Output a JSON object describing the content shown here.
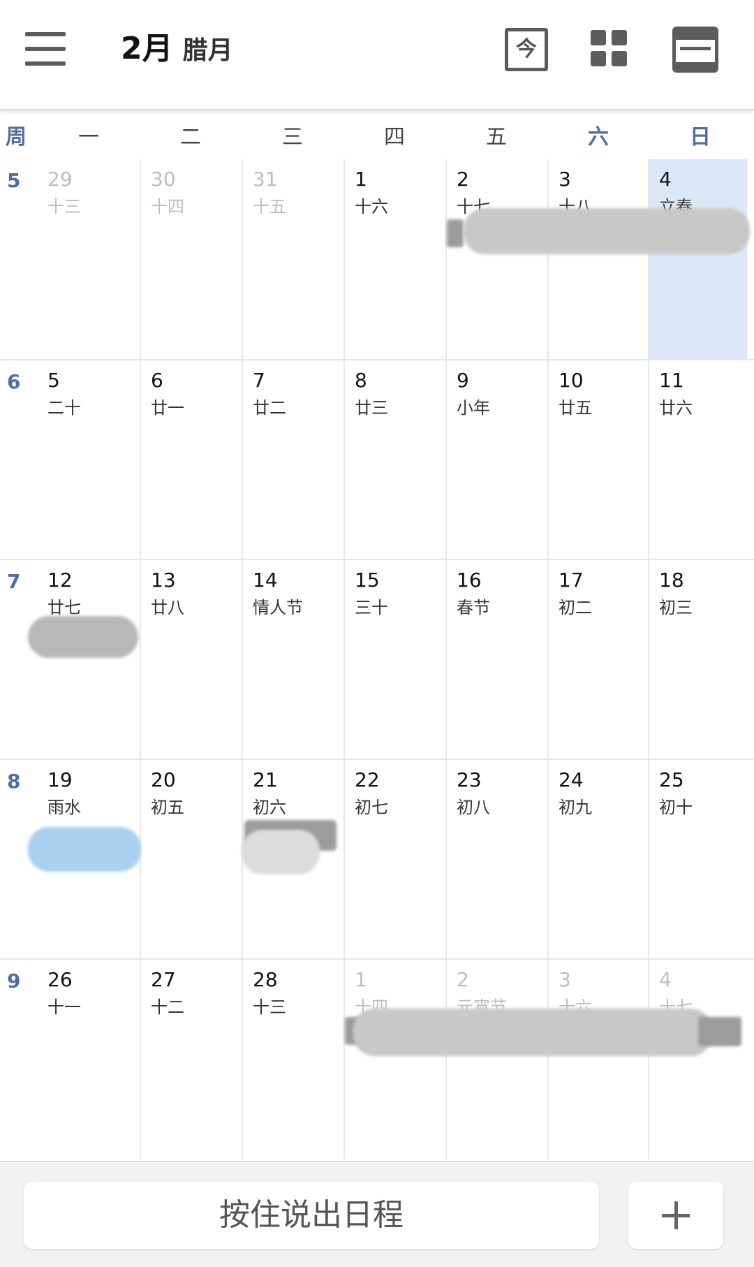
{
  "header": {
    "month": "2月",
    "lunar_month": "腊月",
    "today_label": "今"
  },
  "weekday_headers": [
    "周",
    "一",
    "二",
    "三",
    "四",
    "五",
    "六",
    "日"
  ],
  "weeks": [
    {
      "week_number": "5",
      "days": [
        {
          "day": "29",
          "lunar": "十三",
          "current": false
        },
        {
          "day": "30",
          "lunar": "十四",
          "current": false
        },
        {
          "day": "31",
          "lunar": "十五",
          "current": false
        },
        {
          "day": "1",
          "lunar": "十六",
          "current": true
        },
        {
          "day": "2",
          "lunar": "十七",
          "current": true
        },
        {
          "day": "3",
          "lunar": "十八",
          "current": true
        },
        {
          "day": "4",
          "lunar": "立春",
          "current": true,
          "today": true
        }
      ]
    },
    {
      "week_number": "6",
      "days": [
        {
          "day": "5",
          "lunar": "二十",
          "current": true
        },
        {
          "day": "6",
          "lunar": "廿一",
          "current": true
        },
        {
          "day": "7",
          "lunar": "廿二",
          "current": true
        },
        {
          "day": "8",
          "lunar": "廿三",
          "current": true
        },
        {
          "day": "9",
          "lunar": "小年",
          "current": true
        },
        {
          "day": "10",
          "lunar": "廿五",
          "current": true
        },
        {
          "day": "11",
          "lunar": "廿六",
          "current": true
        }
      ]
    },
    {
      "week_number": "7",
      "days": [
        {
          "day": "12",
          "lunar": "廿七",
          "current": true
        },
        {
          "day": "13",
          "lunar": "廿八",
          "current": true
        },
        {
          "day": "14",
          "lunar": "情人节",
          "current": true
        },
        {
          "day": "15",
          "lunar": "三十",
          "current": true
        },
        {
          "day": "16",
          "lunar": "春节",
          "current": true
        },
        {
          "day": "17",
          "lunar": "初二",
          "current": true
        },
        {
          "day": "18",
          "lunar": "初三",
          "current": true
        }
      ]
    },
    {
      "week_number": "8",
      "days": [
        {
          "day": "19",
          "lunar": "雨水",
          "current": true
        },
        {
          "day": "20",
          "lunar": "初五",
          "current": true
        },
        {
          "day": "21",
          "lunar": "初六",
          "current": true
        },
        {
          "day": "22",
          "lunar": "初七",
          "current": true
        },
        {
          "day": "23",
          "lunar": "初八",
          "current": true
        },
        {
          "day": "24",
          "lunar": "初九",
          "current": true
        },
        {
          "day": "25",
          "lunar": "初十",
          "current": true
        }
      ]
    },
    {
      "week_number": "9",
      "days": [
        {
          "day": "26",
          "lunar": "十一",
          "current": true
        },
        {
          "day": "27",
          "lunar": "十二",
          "current": true
        },
        {
          "day": "28",
          "lunar": "十三",
          "current": true
        },
        {
          "day": "1",
          "lunar": "十四",
          "current": false
        },
        {
          "day": "2",
          "lunar": "元宵节",
          "current": false
        },
        {
          "day": "3",
          "lunar": "十六",
          "current": false
        },
        {
          "day": "4",
          "lunar": "十七",
          "current": false
        }
      ]
    }
  ],
  "bottom": {
    "voice_label": "按住说出日程",
    "add_label": "+"
  },
  "colors": {
    "week_number": "#4d6fa6",
    "today_highlight": "#dce8f8",
    "blue_event": "#a9d0ee"
  }
}
